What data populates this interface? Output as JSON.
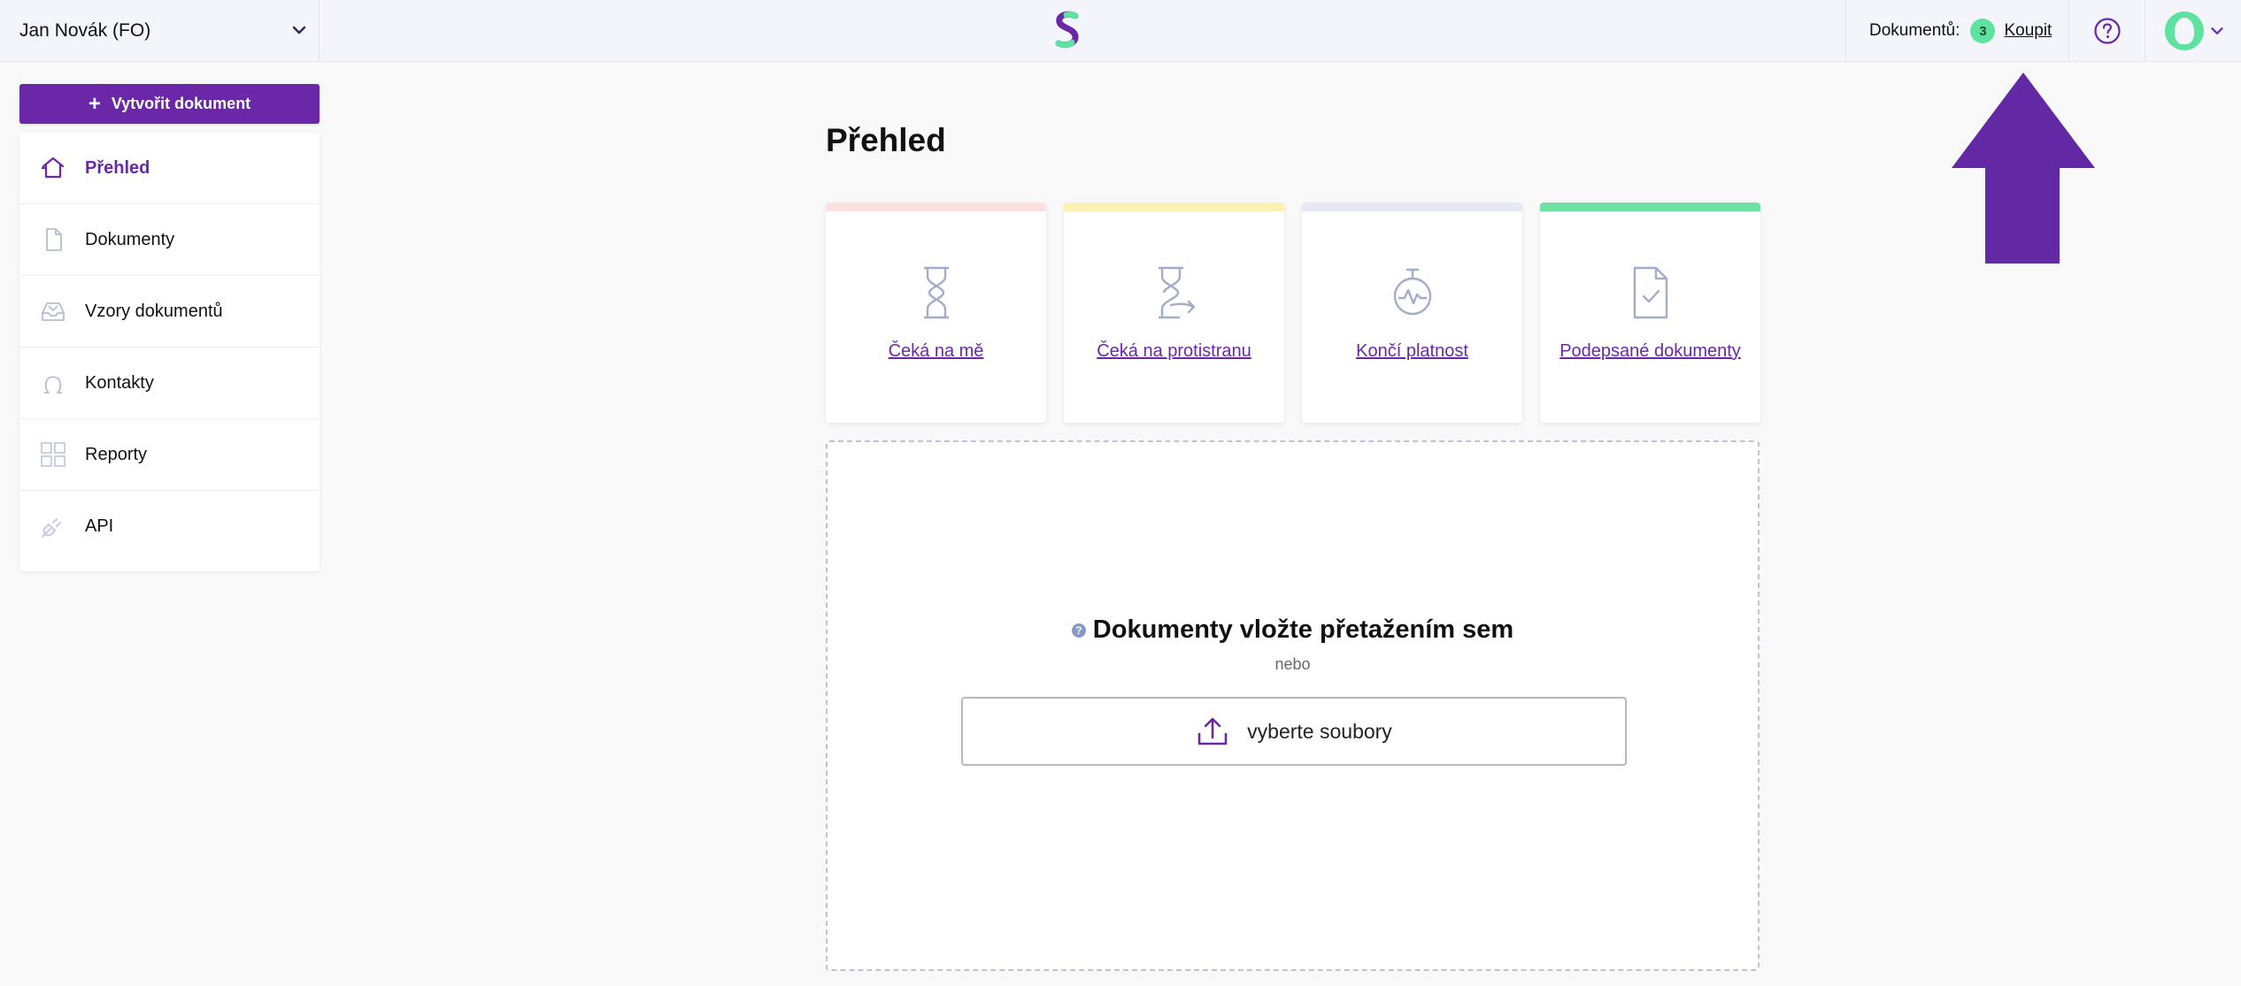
{
  "header": {
    "account_name": "Jan Novák (FO)",
    "credits_label": "Dokumentů:",
    "credits_count": "3",
    "buy_label": "Koupit"
  },
  "sidebar": {
    "create_label": "Vytvořit dokument",
    "items": [
      {
        "label": "Přehled",
        "icon": "home-icon",
        "active": true
      },
      {
        "label": "Dokumenty",
        "icon": "document-icon"
      },
      {
        "label": "Vzory dokumentů",
        "icon": "inbox-icon"
      },
      {
        "label": "Kontakty",
        "icon": "contact-icon"
      },
      {
        "label": "Reporty",
        "icon": "grid-icon"
      },
      {
        "label": "API",
        "icon": "plug-icon"
      }
    ]
  },
  "main": {
    "title": "Přehled",
    "cards": [
      {
        "label": "Čeká na mě",
        "icon": "hourglass-icon",
        "color": "#fde0e0"
      },
      {
        "label": "Čeká na protistranu",
        "icon": "hourglass-arrow-icon",
        "color": "#fdf0b3"
      },
      {
        "label": "Končí platnost",
        "icon": "stopwatch-icon",
        "color": "#e6e9f5"
      },
      {
        "label": "Podepsané dokumenty",
        "icon": "document-check-icon",
        "color": "#6ee0a4"
      }
    ],
    "dropzone": {
      "title": "Dokumenty vložte přetažením sem",
      "or_label": "nebo",
      "button_label": "vyberte soubory"
    }
  },
  "colors": {
    "accent": "#6a28a8",
    "badge": "#5fe2a0",
    "arrow": "#6328a4"
  }
}
